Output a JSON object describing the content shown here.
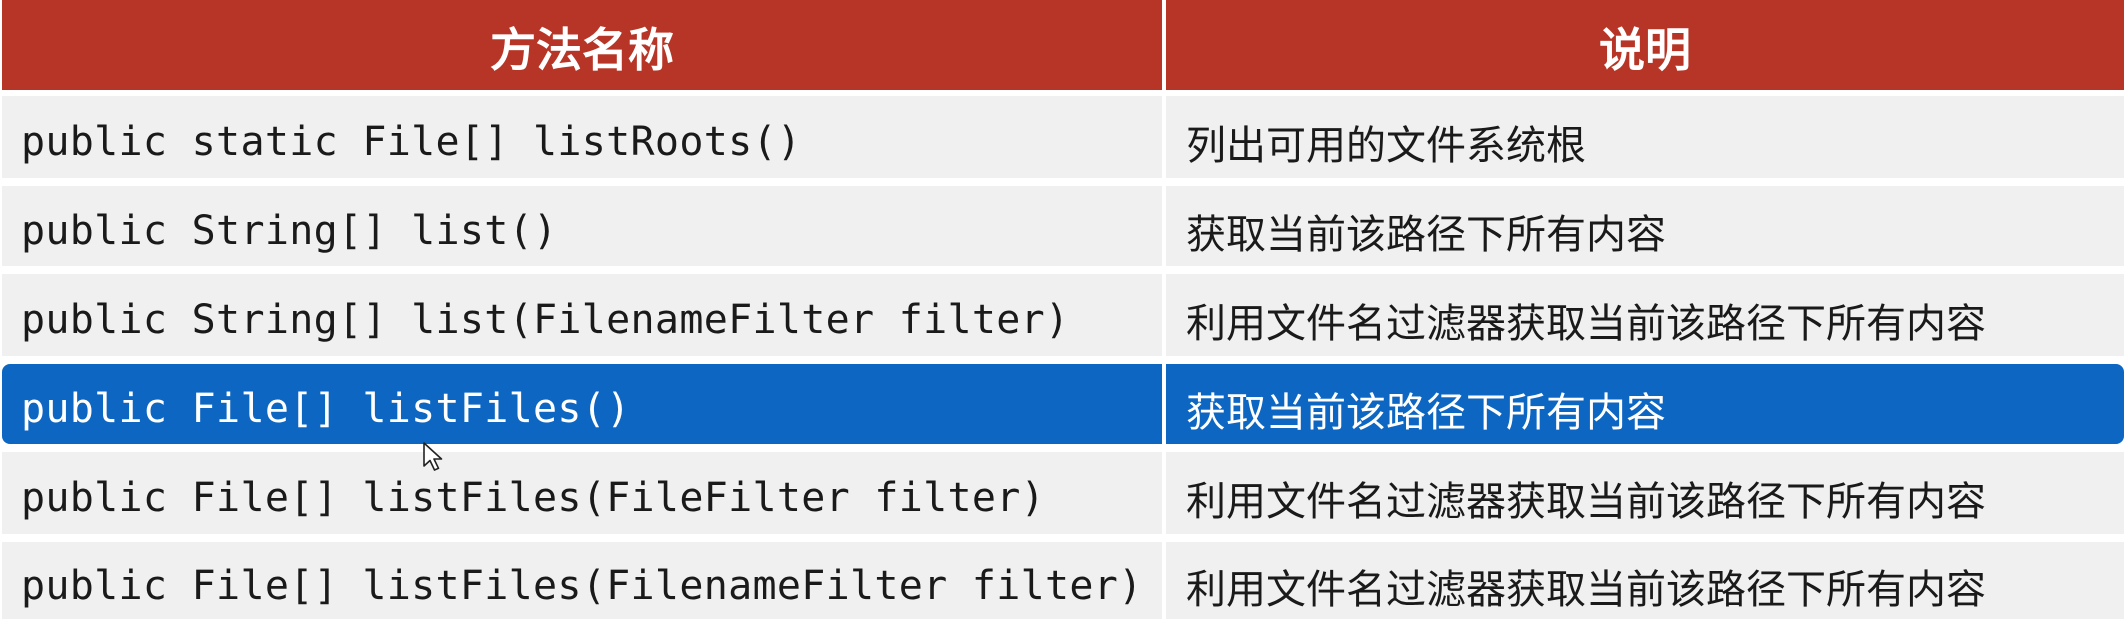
{
  "table": {
    "headers": {
      "method": "方法名称",
      "description": "说明"
    },
    "rows": [
      {
        "method": "public static File[] listRoots()",
        "description": "列出可用的文件系统根"
      },
      {
        "method": "public String[] list()",
        "description": "获取当前该路径下所有内容"
      },
      {
        "method": "public String[] list(FilenameFilter filter)",
        "description": "利用文件名过滤器获取当前该路径下所有内容"
      },
      {
        "method": "public File[] listFiles()",
        "description": "获取当前该路径下所有内容"
      },
      {
        "method": "public File[] listFiles(FileFilter filter)",
        "description": "利用文件名过滤器获取当前该路径下所有内容"
      },
      {
        "method": "public File[] listFiles(FilenameFilter filter)",
        "description": "利用文件名过滤器获取当前该路径下所有内容"
      }
    ],
    "selected_row": 3
  },
  "colors": {
    "header_bg": "#b73526",
    "row_bg": "#f0f0f0",
    "selected_bg": "#0c66c2"
  },
  "cursor": {
    "icon": "mouse-pointer-icon"
  }
}
